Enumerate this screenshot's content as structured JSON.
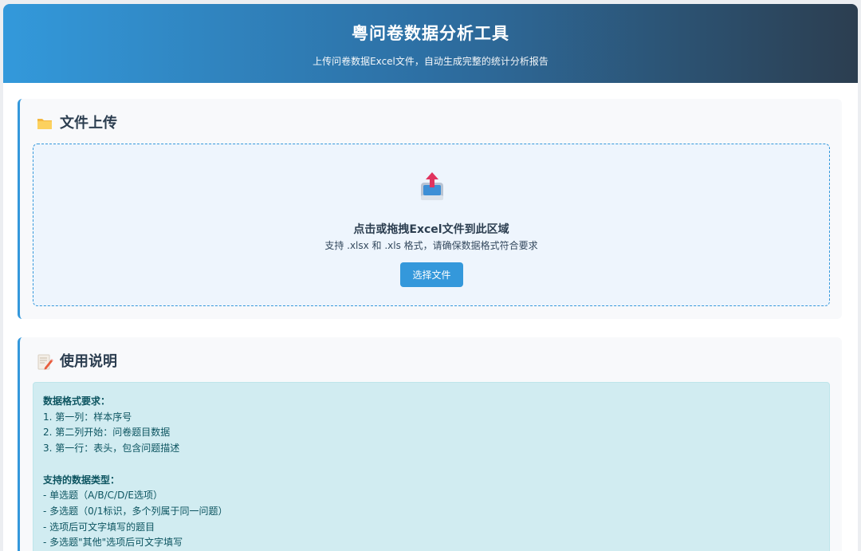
{
  "header": {
    "title": "粤问卷数据分析工具",
    "subtitle": "上传问卷数据Excel文件，自动生成完整的统计分析报告"
  },
  "upload": {
    "title": "文件上传",
    "icon": "folder-icon",
    "dropzone": {
      "icon": "upload-tray-icon",
      "title": "点击或拖拽Excel文件到此区域",
      "subtitle": "支持 .xlsx 和 .xls 格式，请确保数据格式符合要求",
      "button_label": "选择文件"
    }
  },
  "guide": {
    "title": "使用说明",
    "icon": "memo-icon",
    "format_heading": "数据格式要求：",
    "format_items": [
      "1. 第一列：样本序号",
      "2. 第二列开始：问卷题目数据",
      "3. 第一行：表头，包含问题描述"
    ],
    "types_heading": "支持的数据类型：",
    "types_items": [
      "- 单选题（A/B/C/D/E选项）",
      "- 多选题（0/1标识，多个列属于同一问题）",
      "- 选项后可文字填写的题目",
      "- 多选题\"其他\"选项后可文字填写"
    ]
  },
  "colors": {
    "accent": "#3498db",
    "header_dark": "#2c3e50",
    "info_bg": "#d1ecf1",
    "info_text": "#0c5460"
  }
}
